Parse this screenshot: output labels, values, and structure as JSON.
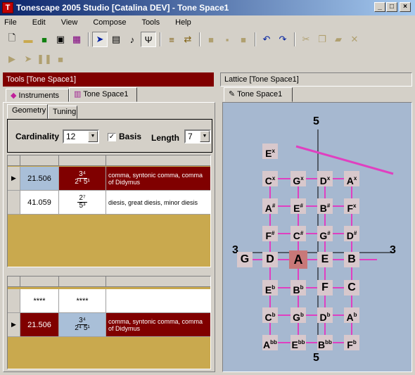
{
  "window": {
    "title": "Tonescape 2005 Studio [Catalina DEV]  -  Tone Space1"
  },
  "menu": [
    "File",
    "Edit",
    "View",
    "Compose",
    "Tools",
    "Help"
  ],
  "left_panel": {
    "title": "Tools [Tone Space1]",
    "tabs": [
      "Instruments",
      "Tone Space1"
    ],
    "subtabs": [
      "Geometry",
      "Tuning"
    ],
    "cardinality_label": "Cardinality",
    "cardinality_value": "12",
    "basis_label": "Basis",
    "length_label": "Length",
    "length_value": "7",
    "table1": [
      {
        "cents": "21.506",
        "num": "3⁴",
        "den": "2⁴ 5¹",
        "name": "comma, syntonic comma, comma of Didymus",
        "selected": true
      },
      {
        "cents": "41.059",
        "num": "2⁷",
        "den": "5³",
        "name": "diesis, great diesis, minor diesis",
        "selected": false
      }
    ],
    "table2": [
      {
        "cents": "****",
        "ratio": "****",
        "name": ""
      },
      {
        "cents": "21.506",
        "num": "3⁴",
        "den": "2⁴ 5¹",
        "name": "comma, syntonic comma, comma of Didymus",
        "selected": true
      }
    ]
  },
  "right_panel": {
    "title": "Lattice [Tone Space1]",
    "tab": "Tone Space1",
    "axis_top": "5",
    "axis_bottom": "5",
    "axis_left": "3",
    "axis_right": "3"
  },
  "lattice_notes": [
    [
      "E",
      "x"
    ],
    [
      "C",
      "x"
    ],
    [
      "G",
      "x"
    ],
    [
      "D",
      "x"
    ],
    [
      "A",
      "x"
    ],
    [
      "A",
      "#"
    ],
    [
      "E",
      "#"
    ],
    [
      "B",
      "#"
    ],
    [
      "F",
      "x"
    ],
    [
      "F",
      "#"
    ],
    [
      "C",
      "#"
    ],
    [
      "G",
      "#"
    ],
    [
      "D",
      "#"
    ],
    [
      "G",
      ""
    ],
    [
      "D",
      ""
    ],
    [
      "A",
      ""
    ],
    [
      "E",
      ""
    ],
    [
      "B",
      ""
    ],
    [
      "E",
      "b"
    ],
    [
      "B",
      "b"
    ],
    [
      "F",
      ""
    ],
    [
      "C",
      ""
    ],
    [
      "C",
      "b"
    ],
    [
      "G",
      "b"
    ],
    [
      "D",
      "b"
    ],
    [
      "A",
      "b"
    ],
    [
      "A",
      "bb"
    ],
    [
      "E",
      "bb"
    ],
    [
      "B",
      "bb"
    ],
    [
      "F",
      "b"
    ]
  ],
  "colors": {
    "title_blue": "#0a246a",
    "maroon": "#800000",
    "lattice_bg": "#a6b8d0",
    "edge_pink": "#e040c0",
    "grid_gold": "#c9a94e"
  }
}
